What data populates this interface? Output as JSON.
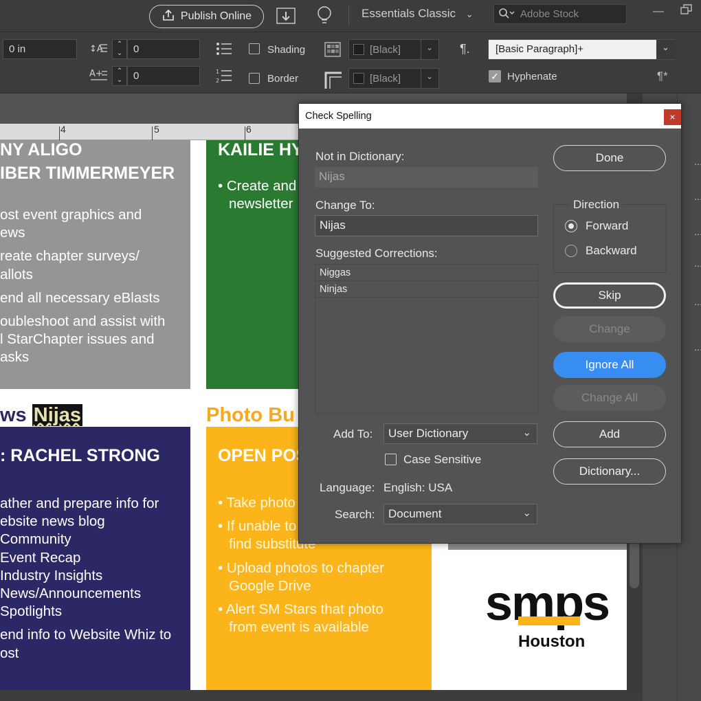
{
  "topbar": {
    "publish_label": "Publish Online",
    "workspace_label": "Essentials Classic",
    "stock_placeholder": "Adobe Stock"
  },
  "controls": {
    "width_field": "0 in",
    "baseline_field": "0",
    "space_field": "0",
    "shading_label": "Shading",
    "border_label": "Border",
    "shading_swatch": "[Black]",
    "border_swatch": "[Black]",
    "paragraph_style": "[Basic Paragraph]+",
    "hyphenate_label": "Hyphenate",
    "hyphenate_checked": true
  },
  "ruler": {
    "marks": [
      "4",
      "5",
      "6"
    ]
  },
  "document": {
    "gray_panel": {
      "title_1": "NY ALIGO",
      "title_2": "IBER TIMMERMEYER",
      "bullets": [
        "ost event graphics and",
        "ews",
        "reate chapter surveys/",
        "allots",
        "end all necessary eBlasts",
        "oubleshoot and assist with",
        "l StarChapter issues and",
        "asks"
      ]
    },
    "green_panel": {
      "title": "KAILIE HY",
      "bullets": [
        "Create and",
        "newsletter"
      ]
    },
    "news_heading": "ws",
    "misspelled_word": "Nijas",
    "photo_heading": "Photo Bu",
    "purple_panel": {
      "title": ": RACHEL STRONG",
      "lines": [
        "ather and prepare info for",
        "ebsite news blog",
        "Community",
        "Event Recap",
        "Industry Insights",
        "News/Announcements",
        "Spotlights",
        "end info to Website Whiz to",
        "ost"
      ]
    },
    "yellow_panel": {
      "title": "OPEN POS",
      "bullets": [
        "Take photo",
        "If unable to",
        "find substitute",
        "Upload photos to chapter",
        "Google Drive",
        "Alert SM Stars that photo",
        "from event is available"
      ]
    },
    "logo": {
      "word": "smps",
      "city": "Houston"
    }
  },
  "dialog": {
    "title": "Check Spelling",
    "close_glyph": "×",
    "not_in_dictionary_label": "Not in Dictionary:",
    "not_in_dictionary_value": "Nijas",
    "change_to_label": "Change To:",
    "change_to_value": "Nijas",
    "suggested_label": "Suggested Corrections:",
    "suggestions": [
      "Niggas",
      "Ninjas"
    ],
    "add_to_label": "Add To:",
    "add_to_value": "User Dictionary",
    "case_sensitive_label": "Case Sensitive",
    "language_label": "Language:",
    "language_value": "English: USA",
    "search_label": "Search:",
    "search_value": "Document",
    "direction_label": "Direction",
    "forward_label": "Forward",
    "backward_label": "Backward",
    "buttons": {
      "done": "Done",
      "skip": "Skip",
      "change": "Change",
      "ignore_all": "Ignore All",
      "change_all": "Change All",
      "add": "Add",
      "dictionary": "Dictionary..."
    }
  },
  "colors": {
    "gray_panel": "#959595",
    "green_panel": "#2a7a32",
    "purple_panel": "#2c2866",
    "yellow_panel": "#fbb419",
    "photo_heading": "#f6a91c",
    "primary_button": "#378ef0",
    "highlight": "#141414"
  }
}
